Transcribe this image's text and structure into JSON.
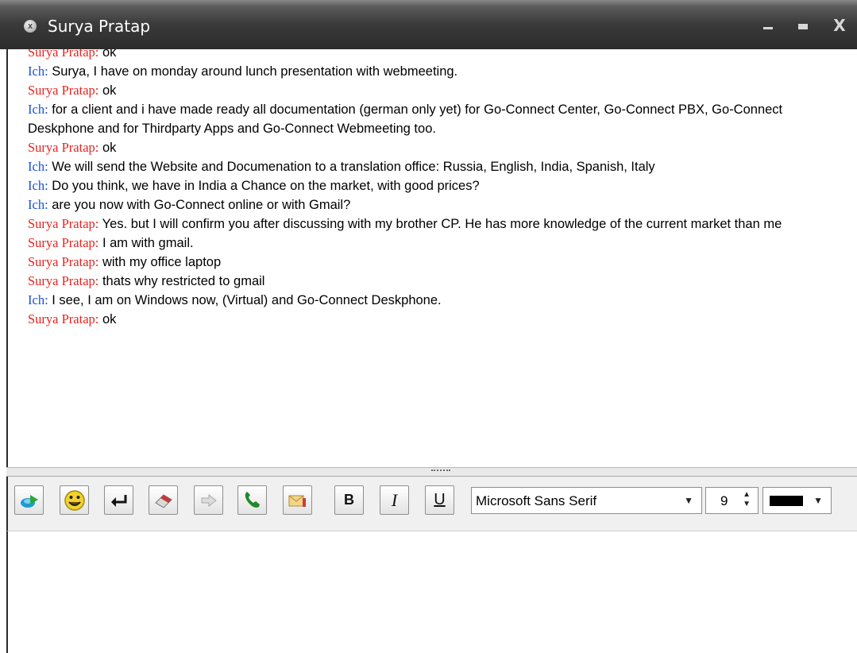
{
  "window": {
    "title": "Surya Pratap",
    "close_circle_glyph": "x",
    "minimize_icon": "minimize-icon",
    "maximize_icon": "maximize-icon",
    "close_label": "X"
  },
  "messages": [
    {
      "sender": "Surya Pratap:",
      "who": "them",
      "text": "ok"
    },
    {
      "sender": "Ich:",
      "who": "me",
      "text": "Surya, I have on monday around lunch presentation with webmeeting."
    },
    {
      "sender": "Surya Pratap:",
      "who": "them",
      "text": "ok"
    },
    {
      "sender": "Ich:",
      "who": "me",
      "text": "for a client and i have made ready all documentation (german only yet) for Go-Connect Center, Go-Connect PBX, Go-Connect Deskphone and for Thirdparty Apps and Go-Connect Webmeeting too."
    },
    {
      "sender": "Surya Pratap:",
      "who": "them",
      "text": "ok"
    },
    {
      "sender": "Ich:",
      "who": "me",
      "text": "We will send the Website and Documenation to a translation office: Russia, English, India, Spanish, Italy"
    },
    {
      "sender": "Ich:",
      "who": "me",
      "text": "Do you think, we have in India a Chance on the market, with good prices?"
    },
    {
      "sender": "Ich:",
      "who": "me",
      "text": "are you now with Go-Connect online or with Gmail?"
    },
    {
      "sender": "Surya Pratap:",
      "who": "them",
      "text": "Yes. but I will confirm you after discussing with my brother CP. He has more knowledge of the current market than me"
    },
    {
      "sender": "Surya Pratap:",
      "who": "them",
      "text": "I am with gmail."
    },
    {
      "sender": "Surya Pratap:",
      "who": "them",
      "text": "with my office laptop"
    },
    {
      "sender": "Surya Pratap:",
      "who": "them",
      "text": "thats why restricted to gmail"
    },
    {
      "sender": "Ich:",
      "who": "me",
      "text": "I see, I am on Windows now, (Virtual) and Go-Connect Deskphone."
    },
    {
      "sender": "Surya Pratap:",
      "who": "them",
      "text": "ok"
    }
  ],
  "colors": {
    "them_sender": "#e8231e",
    "me_sender": "#1a50d8",
    "selected_text_color": "#000000"
  },
  "toolbar": {
    "icons": [
      "send-file-icon",
      "emoticon-icon",
      "enter-icon",
      "eraser-icon",
      "forward-icon",
      "phone-icon",
      "mail-icon"
    ],
    "bold_label": "B",
    "italic_label": "I",
    "underline_label": "U",
    "font_family": "Microsoft Sans Serif",
    "font_size": "9"
  }
}
